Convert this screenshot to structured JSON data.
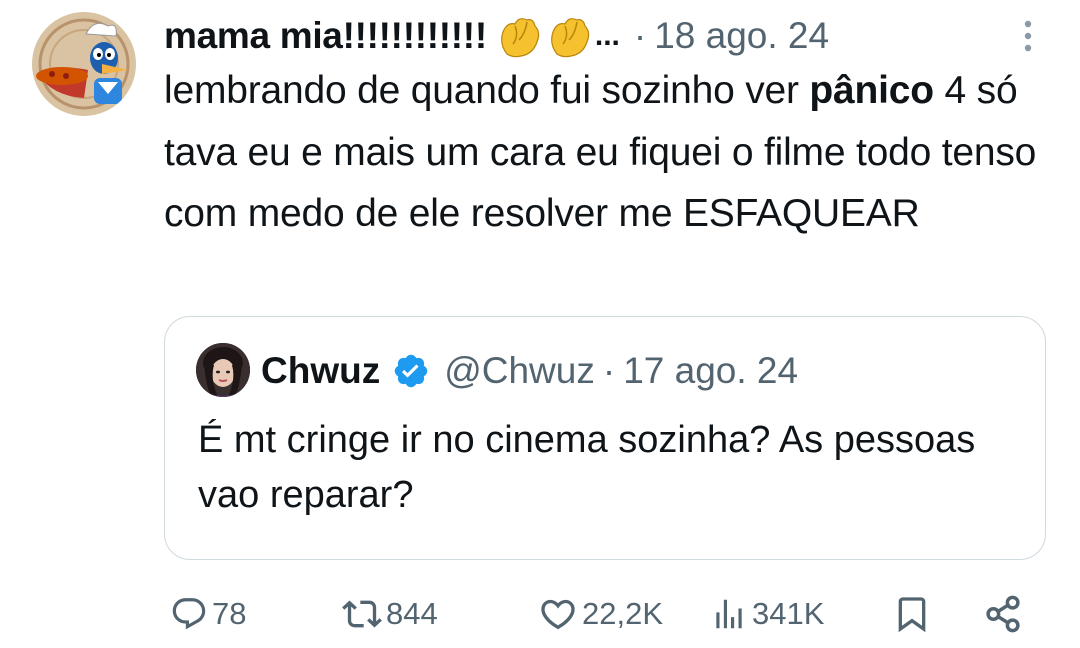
{
  "tweet": {
    "author_name": "mama mia!!!!!!!!!!!!",
    "emoji_icons": [
      "pinched-fingers-icon",
      "pinched-fingers-icon"
    ],
    "name_ellipsis": "...",
    "separator": "·",
    "date": "18 ago. 24",
    "text_part1": "lembrando de quando fui sozinho ver",
    "text_bold": "pânico",
    "text_part2": " 4 só tava eu e mais um cara eu fiquei o filme todo tenso com medo de ele resolver me ESFAQUEAR"
  },
  "quoted": {
    "author_name": "Chwuz",
    "verified_icon": "verified-badge-icon",
    "handle": "@Chwuz",
    "separator": "·",
    "date": "17 ago. 24",
    "text": "É mt cringe ir no cinema sozinha? As pessoas vao reparar?"
  },
  "actions": {
    "replies": "78",
    "reposts": "844",
    "likes": "22,2K",
    "views": "341K",
    "icons": [
      "reply-icon",
      "repost-icon",
      "like-icon",
      "views-icon",
      "bookmark-icon",
      "share-icon"
    ]
  },
  "colors": {
    "text": "#0f1419",
    "secondary": "#536471",
    "border": "#cfd9de",
    "verified": "#1d9bf0",
    "emoji": "#f6c12e"
  }
}
